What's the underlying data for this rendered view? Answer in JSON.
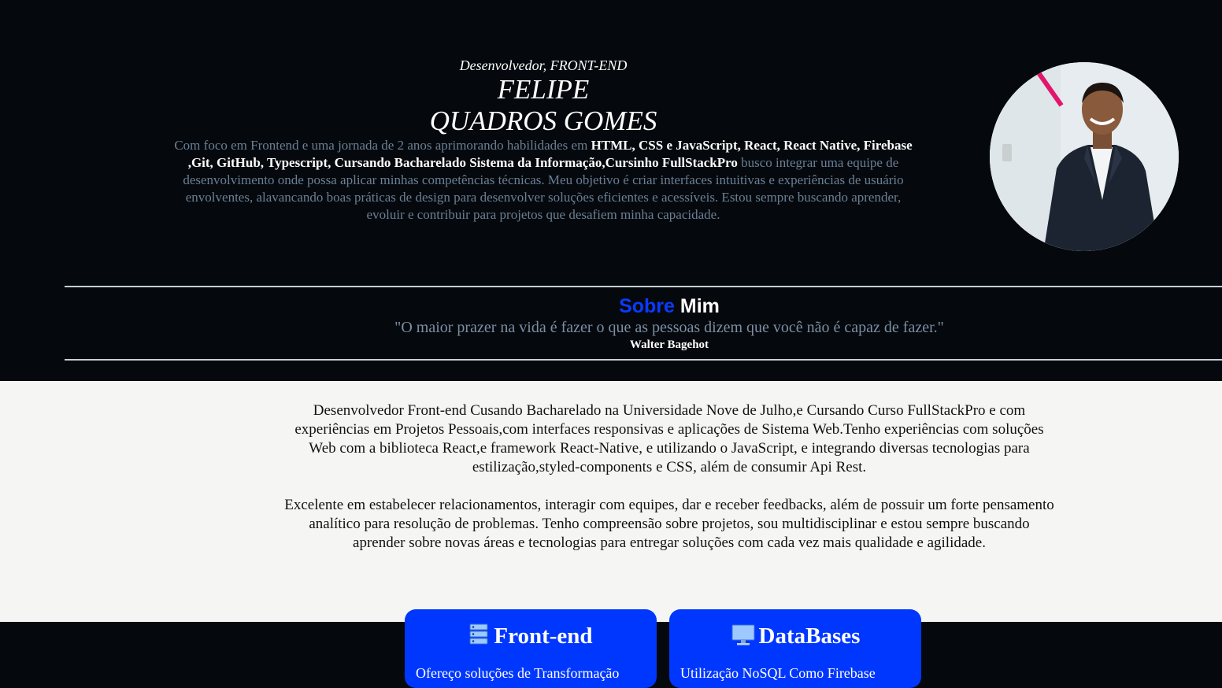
{
  "header": {
    "role": "Desenvolvedor, FRONT-END",
    "name_line1": "FELIPE",
    "name_line2": "QUADROS GOMES",
    "intro_part1": "Com foco em Frontend e uma jornada de 2 anos aprimorando habilidades em ",
    "intro_skills": "HTML, CSS e JavaScript, React, React Native, Firebase ,Git, GitHub, Typescript, Cursando Bacharelado Sistema da Informação,Cursinho FullStackPro",
    "intro_part2": " busco integrar uma equipe de desenvolvimento onde possa aplicar minhas competências técnicas. Meu objetivo é criar interfaces intuitivas e experiências de usuário envolventes, alavancando boas práticas de design para desenvolver soluções eficientes e acessíveis. Estou sempre buscando aprender, evoluir e contribuir para projetos que desafiem minha capacidade."
  },
  "about": {
    "heading_blue": "Sobre",
    "heading_white": "Mim",
    "quote": "\"O maior prazer na vida é fazer o que as pessoas dizem que você não é capaz de fazer.\"",
    "quote_author": "Walter Bagehot",
    "paragraph1": "Desenvolvedor Front-end Cusando Bacharelado na Universidade Nove de Julho,e Cursando Curso FullStackPro e com experiências em Projetos Pessoais,com interfaces responsivas e aplicações de Sistema Web.Tenho experiências com soluções Web com a biblioteca React,e framework React-Native, e utilizando o JavaScript, e integrando diversas tecnologias para estilização,styled-components e CSS, além de consumir Api Rest.",
    "paragraph2": "Excelente em estabelecer relacionamentos, interagir com equipes, dar e receber feedbacks, além de possuir um forte pensamento analítico para resolução de problemas. Tenho compreensão sobre projetos, sou multidisciplinar e estou sempre buscando aprender sobre novas áreas e tecnologias para entregar soluções com cada vez mais qualidade e agilidade."
  },
  "cards": [
    {
      "title": "Front-end",
      "icon": "server-stack-icon",
      "desc": "Ofereço soluções de Transformação"
    },
    {
      "title": "DataBases",
      "icon": "desktop-monitor-icon",
      "desc": "Utilização NoSQL Como Firebase"
    }
  ],
  "colors": {
    "background_dark": "#05090d",
    "background_light": "#f5f5f3",
    "accent_blue": "#0037ff",
    "muted_text": "#6b7f95"
  }
}
